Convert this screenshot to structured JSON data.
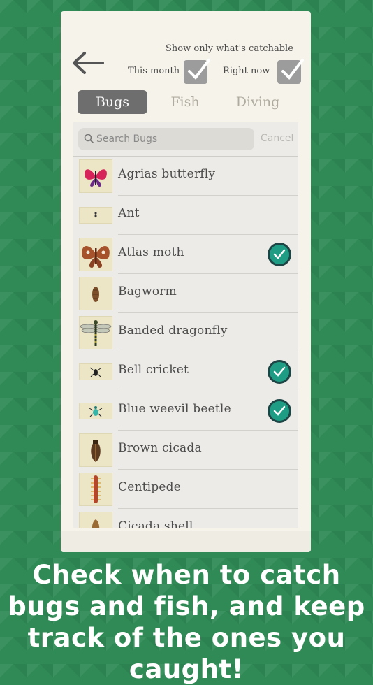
{
  "header": {
    "back_icon": "back-arrow-icon",
    "filter_title": "Show only what's catchable",
    "this_month_label": "This month",
    "right_now_label": "Right now",
    "this_month_checked": true,
    "right_now_checked": true
  },
  "tabs": [
    {
      "label": "Bugs",
      "active": true
    },
    {
      "label": "Fish",
      "active": false
    },
    {
      "label": "Diving",
      "active": false
    }
  ],
  "search": {
    "placeholder": "Search Bugs",
    "value": "",
    "cancel_label": "Cancel",
    "icon": "search-icon"
  },
  "bugs": [
    {
      "name": "Agrias butterfly",
      "caught": false,
      "icon": "butterfly-icon"
    },
    {
      "name": "Ant",
      "caught": false,
      "icon": "ant-icon"
    },
    {
      "name": "Atlas moth",
      "caught": true,
      "icon": "moth-icon"
    },
    {
      "name": "Bagworm",
      "caught": false,
      "icon": "bagworm-icon"
    },
    {
      "name": "Banded dragonfly",
      "caught": false,
      "icon": "dragonfly-icon"
    },
    {
      "name": "Bell cricket",
      "caught": true,
      "icon": "cricket-icon"
    },
    {
      "name": "Blue weevil beetle",
      "caught": true,
      "icon": "beetle-icon"
    },
    {
      "name": "Brown cicada",
      "caught": false,
      "icon": "cicada-icon"
    },
    {
      "name": "Centipede",
      "caught": false,
      "icon": "centipede-icon"
    },
    {
      "name": "Cicada shell",
      "caught": false,
      "icon": "cicada-shell-icon"
    }
  ],
  "caption": "Check when to catch bugs and fish, and keep track of the ones you caught!",
  "colors": {
    "background": "#2f8a55",
    "card": "#f6f3ea",
    "active_tab": "#6e6e6e",
    "caught_check": "#1f9c84"
  }
}
